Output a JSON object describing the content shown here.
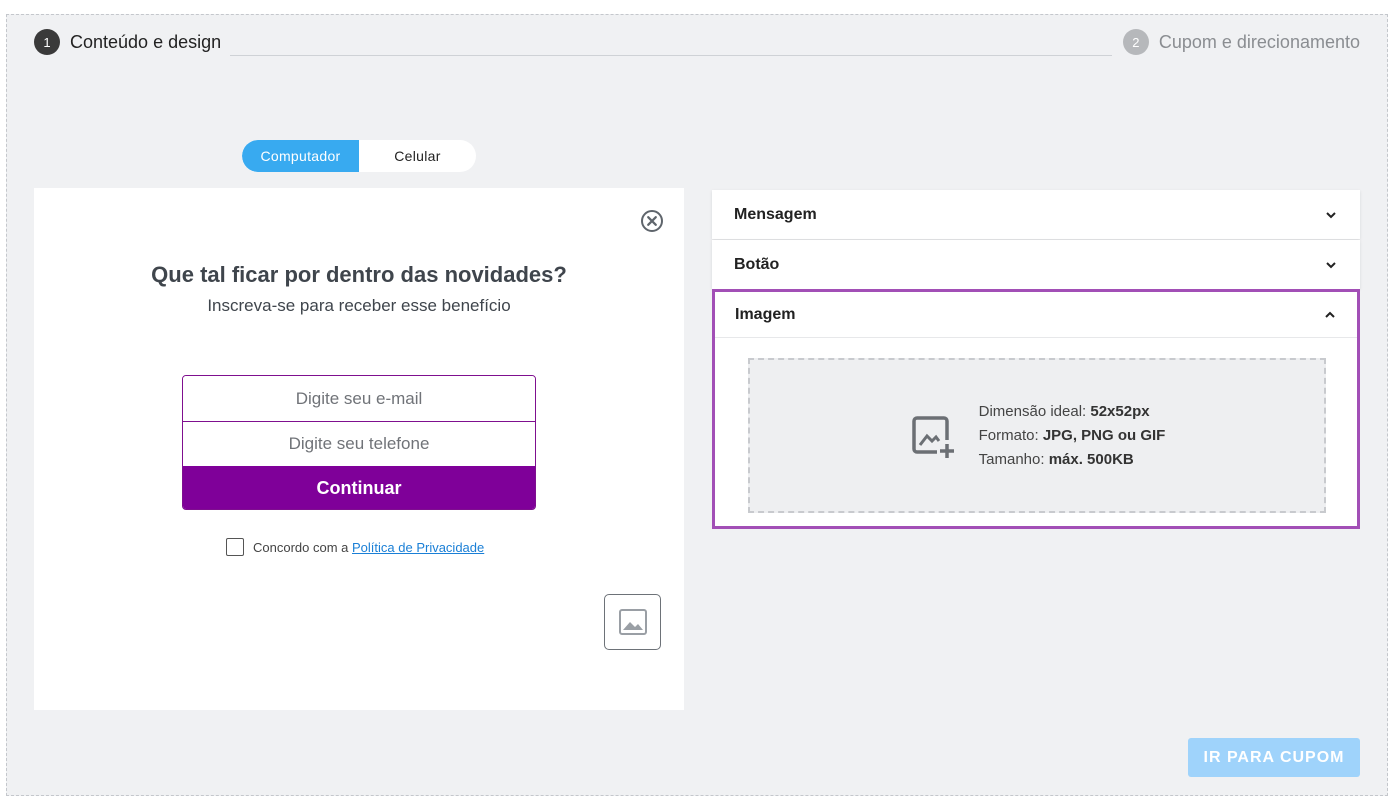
{
  "stepper": {
    "step1": {
      "number": "1",
      "label": "Conteúdo e design"
    },
    "step2": {
      "number": "2",
      "label": "Cupom e direcionamento"
    }
  },
  "device_toggle": {
    "options": [
      "Computador",
      "Celular"
    ],
    "selected": "Computador"
  },
  "preview": {
    "close_icon": "close-circle-icon",
    "title": "Que tal ficar por dentro das novidades?",
    "subtitle": "Inscreva-se para receber esse benefício",
    "email_placeholder": "Digite seu e-mail",
    "phone_placeholder": "Digite seu telefone",
    "cta_label": "Continuar",
    "consent_text": "Concordo com a ",
    "consent_link": "Política de Privacidade",
    "image_placeholder_icon": "image-icon"
  },
  "accordion": {
    "sections": [
      {
        "label": "Mensagem",
        "expanded": false
      },
      {
        "label": "Botão",
        "expanded": false
      },
      {
        "label": "Imagem",
        "expanded": true
      }
    ],
    "image_upload": {
      "icon": "add-image-icon",
      "dimension_label": "Dimensão ideal: ",
      "dimension_value": "52x52px",
      "format_label": "Formato: ",
      "format_value": "JPG, PNG ou GIF",
      "size_label": "Tamanho: ",
      "size_value": "máx. 500KB"
    }
  },
  "footer": {
    "next_label": "IR PARA CUPOM"
  },
  "colors": {
    "accent_blue": "#38aaf0",
    "cta_purple": "#7f0099",
    "highlight_border": "#a24fb6",
    "next_button": "#9fd3fb"
  }
}
